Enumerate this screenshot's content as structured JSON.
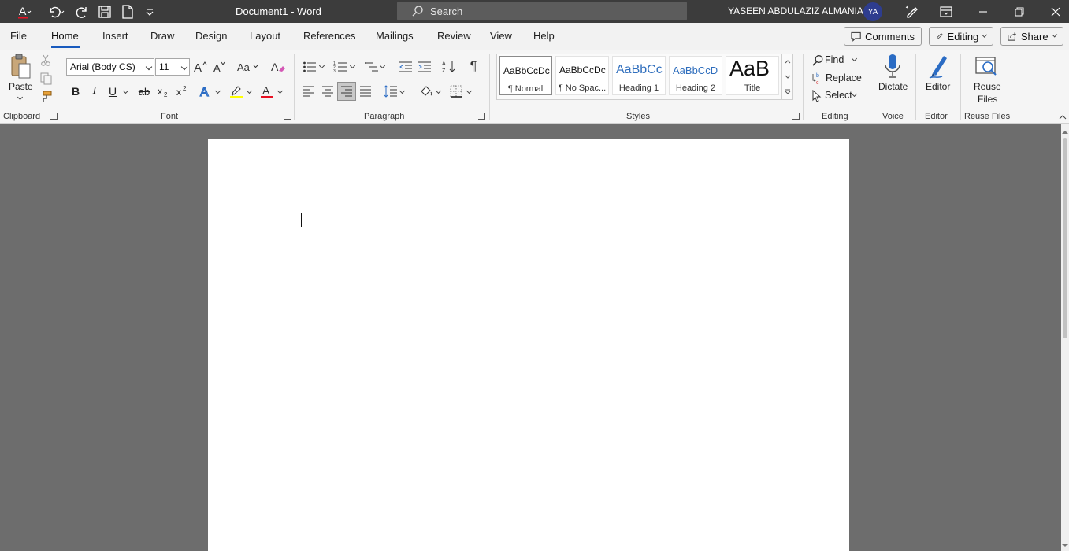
{
  "titlebar": {
    "doc_title": "Document1  -  Word",
    "search_placeholder": "Search",
    "user_name": "YASEEN ABDULAZIZ ALMANIA",
    "avatar_initials": "YA"
  },
  "menu": {
    "tabs": [
      "File",
      "Home",
      "Insert",
      "Draw",
      "Design",
      "Layout",
      "References",
      "Mailings",
      "Review",
      "View",
      "Help"
    ],
    "active_tab": "Home",
    "comments_label": "Comments",
    "editing_label": "Editing",
    "share_label": "Share"
  },
  "ribbon": {
    "clipboard": {
      "label": "Clipboard",
      "paste_label": "Paste"
    },
    "font": {
      "label": "Font",
      "font_name": "Arial (Body CS)",
      "font_size": "11"
    },
    "paragraph": {
      "label": "Paragraph"
    },
    "styles": {
      "label": "Styles",
      "items": [
        {
          "preview": "AaBbCcDc",
          "name": "¶ Normal"
        },
        {
          "preview": "AaBbCcDc",
          "name": "¶ No Spac..."
        },
        {
          "preview": "AaBbCc",
          "name": "Heading 1"
        },
        {
          "preview": "AaBbCcD",
          "name": "Heading 2"
        },
        {
          "preview": "AaB",
          "name": "Title"
        }
      ]
    },
    "editing": {
      "label": "Editing",
      "find": "Find",
      "replace": "Replace",
      "select": "Select"
    },
    "voice": {
      "label": "Voice",
      "dictate": "Dictate"
    },
    "editor": {
      "label": "Editor",
      "editor_btn": "Editor"
    },
    "reuse": {
      "label": "Reuse Files",
      "btn_line1": "Reuse",
      "btn_line2": "Files"
    }
  },
  "colors": {
    "titlebar": "#3c3c3c",
    "accent": "#185abd",
    "workspace": "#6d6d6d",
    "font_color": "#e81123",
    "highlight": "#ffff00"
  }
}
